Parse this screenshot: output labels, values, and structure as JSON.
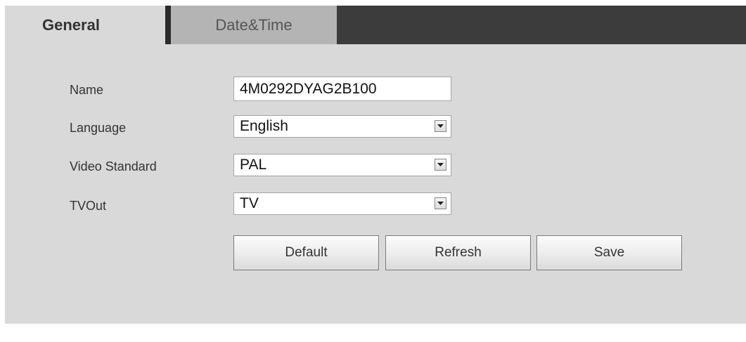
{
  "tabs": {
    "general": "General",
    "date_time": "Date&Time"
  },
  "form": {
    "name": {
      "label": "Name",
      "value": "4M0292DYAG2B100"
    },
    "language": {
      "label": "Language",
      "value": "English"
    },
    "video_standard": {
      "label": "Video Standard",
      "value": "PAL"
    },
    "tvout": {
      "label": "TVOut",
      "value": "TV"
    }
  },
  "buttons": {
    "default": "Default",
    "refresh": "Refresh",
    "save": "Save"
  },
  "colors": {
    "panel_bg": "#d9d9d9",
    "tabbar_bg": "#3c3c3c",
    "inactive_tab_bg": "#b4b4b4"
  },
  "icons": {
    "dropdown": "chevron-down-icon"
  }
}
